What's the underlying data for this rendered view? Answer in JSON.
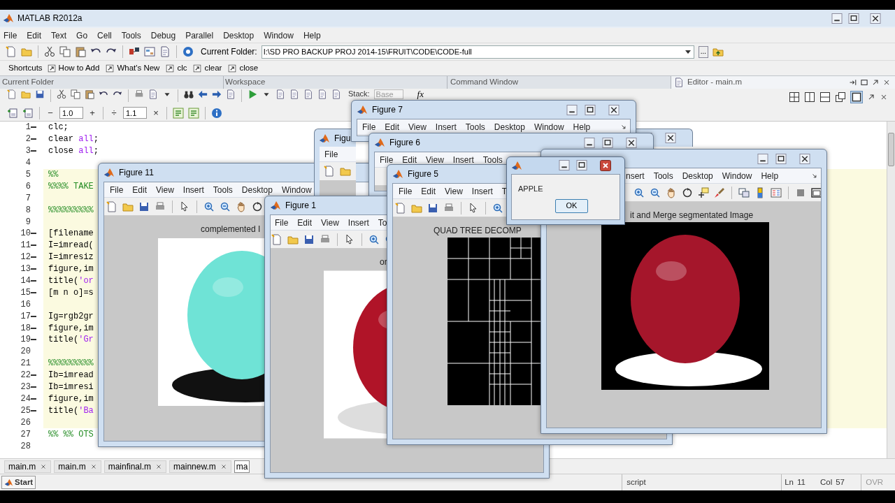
{
  "window": {
    "title": "MATLAB  R2012a"
  },
  "menu": [
    "File",
    "Edit",
    "Text",
    "Go",
    "Cell",
    "Tools",
    "Debug",
    "Parallel",
    "Desktop",
    "Window",
    "Help"
  ],
  "toolbar": {
    "current_folder_label": "Current Folder:",
    "current_folder": "I:\\SD PRO BACKUP PROJ 2014-15\\FRUIT\\CODE\\CODE-full",
    "browse_button": "..."
  },
  "shortcuts": {
    "label": "Shortcuts",
    "items": [
      "How to Add",
      "What's New",
      "clc",
      "clear",
      "close"
    ]
  },
  "panels": [
    "Current Folder",
    "Workspace",
    "Command Window",
    "Editor - main.m"
  ],
  "editor_toolbar": {
    "stack_label": "Stack:",
    "stack": "Base",
    "fx": "fx",
    "minus": "−",
    "cell_a": "1.0",
    "plus": "+",
    "divide": "÷",
    "cell_b": "1.1",
    "times": "×"
  },
  "code_lines": [
    {
      "number": "1",
      "executable": true,
      "cell": false,
      "tokens": [
        {
          "text": "clc;",
          "kind": "plain"
        }
      ]
    },
    {
      "number": "2",
      "executable": true,
      "cell": false,
      "tokens": [
        {
          "text": "clear ",
          "kind": "plain"
        },
        {
          "text": "all",
          "kind": "keyword"
        },
        {
          "text": ";",
          "kind": "plain"
        }
      ]
    },
    {
      "number": "3",
      "executable": true,
      "cell": false,
      "tokens": [
        {
          "text": "close ",
          "kind": "plain"
        },
        {
          "text": "all",
          "kind": "keyword"
        },
        {
          "text": ";",
          "kind": "plain"
        }
      ]
    },
    {
      "number": "4",
      "executable": false,
      "cell": false
    },
    {
      "number": "5",
      "executable": false,
      "cell": true,
      "tokens": [
        {
          "text": "%%",
          "kind": "comment"
        }
      ]
    },
    {
      "number": "6",
      "executable": false,
      "cell": true,
      "tokens": [
        {
          "text": "%%%% TAKE",
          "kind": "comment"
        }
      ]
    },
    {
      "number": "7",
      "executable": false,
      "cell": true
    },
    {
      "number": "8",
      "executable": false,
      "cell": true,
      "tokens": [
        {
          "text": "%%%%%%%%%",
          "kind": "comment"
        }
      ]
    },
    {
      "number": "9",
      "executable": false,
      "cell": true
    },
    {
      "number": "10",
      "executable": true,
      "cell": true,
      "tokens": [
        {
          "text": "[filename",
          "kind": "plain"
        }
      ]
    },
    {
      "number": "11",
      "executable": true,
      "cell": true,
      "tokens": [
        {
          "text": "I=imread(",
          "kind": "plain"
        }
      ]
    },
    {
      "number": "12",
      "executable": true,
      "cell": true,
      "tokens": [
        {
          "text": "I=imresiz",
          "kind": "plain"
        }
      ]
    },
    {
      "number": "13",
      "executable": true,
      "cell": true,
      "tokens": [
        {
          "text": "figure,im",
          "kind": "plain"
        }
      ]
    },
    {
      "number": "14",
      "executable": true,
      "cell": true,
      "tokens": [
        {
          "text": "title(",
          "kind": "plain"
        },
        {
          "text": "'or",
          "kind": "string"
        }
      ]
    },
    {
      "number": "15",
      "executable": true,
      "cell": true,
      "tokens": [
        {
          "text": "[m n o]=s",
          "kind": "plain"
        }
      ]
    },
    {
      "number": "16",
      "executable": false,
      "cell": true
    },
    {
      "number": "17",
      "executable": true,
      "cell": true,
      "tokens": [
        {
          "text": "Ig=rgb2gr",
          "kind": "plain"
        }
      ]
    },
    {
      "number": "18",
      "executable": true,
      "cell": true,
      "tokens": [
        {
          "text": "figure,im",
          "kind": "plain"
        }
      ]
    },
    {
      "number": "19",
      "executable": true,
      "cell": true,
      "tokens": [
        {
          "text": "title(",
          "kind": "plain"
        },
        {
          "text": "'Gr",
          "kind": "string"
        }
      ]
    },
    {
      "number": "20",
      "executable": false,
      "cell": true
    },
    {
      "number": "21",
      "executable": false,
      "cell": true,
      "tokens": [
        {
          "text": "%%%%%%%%%",
          "kind": "comment"
        }
      ]
    },
    {
      "number": "22",
      "executable": true,
      "cell": true,
      "tokens": [
        {
          "text": "Ib=imread",
          "kind": "plain"
        }
      ]
    },
    {
      "number": "23",
      "executable": true,
      "cell": true,
      "tokens": [
        {
          "text": "Ib=imresi",
          "kind": "plain"
        }
      ]
    },
    {
      "number": "24",
      "executable": true,
      "cell": true,
      "tokens": [
        {
          "text": "figure,im",
          "kind": "plain"
        }
      ]
    },
    {
      "number": "25",
      "executable": true,
      "cell": true,
      "tokens": [
        {
          "text": "title(",
          "kind": "plain"
        },
        {
          "text": "'Ba",
          "kind": "string"
        }
      ]
    },
    {
      "number": "26",
      "executable": false,
      "cell": true
    },
    {
      "number": "27",
      "executable": false,
      "cell": false,
      "tokens": [
        {
          "text": "%% %% OTS",
          "kind": "comment"
        }
      ]
    },
    {
      "number": "28",
      "executable": false,
      "cell": false
    }
  ],
  "editor_tabs": [
    {
      "label": "main.m",
      "selected": false
    },
    {
      "label": "main.m",
      "selected": false
    },
    {
      "label": "mainfinal.m",
      "selected": false
    },
    {
      "label": "mainnew.m",
      "selected": false
    },
    {
      "label": "ma",
      "selected": true
    }
  ],
  "status_bar": {
    "start": "Start",
    "mode": "script",
    "ln_label": "Ln",
    "ln": "11",
    "col_label": "Col",
    "col": "57",
    "ovr": "OVR"
  },
  "figures": [
    {
      "title": "Figure 11",
      "menus": [
        "File",
        "Edit",
        "View",
        "Insert",
        "Tools",
        "Desktop",
        "Window"
      ],
      "plot_title": "complemented I",
      "kind": "photo"
    },
    {
      "title": "Figu",
      "menus": [
        "File"
      ]
    },
    {
      "title": "Figure 7",
      "menus": [
        "File",
        "Edit",
        "View",
        "Insert",
        "Tools",
        "Desktop",
        "Window",
        "Help"
      ]
    },
    {
      "title": "Figure 6",
      "menus": [
        "File",
        "Edit",
        "View",
        "Insert",
        "Tools"
      ]
    },
    {
      "title": "Figure 1",
      "menus": [
        "File",
        "Edit",
        "View",
        "Insert",
        "To"
      ],
      "plot_title": "or",
      "kind": "photo"
    },
    {
      "title": "Figure 5",
      "menus": [
        "File",
        "Edit",
        "View",
        "Insert",
        "T"
      ],
      "plot_title": "QUAD TREE DECOMP",
      "kind": "quadtree"
    },
    {
      "menus": [
        "nsert",
        "Tools",
        "Desktop",
        "Window",
        "Help"
      ],
      "plot_title": "it and Merge segmentated Image",
      "kind": "photo"
    }
  ],
  "dialog": {
    "message": "APPLE",
    "button": "OK"
  }
}
